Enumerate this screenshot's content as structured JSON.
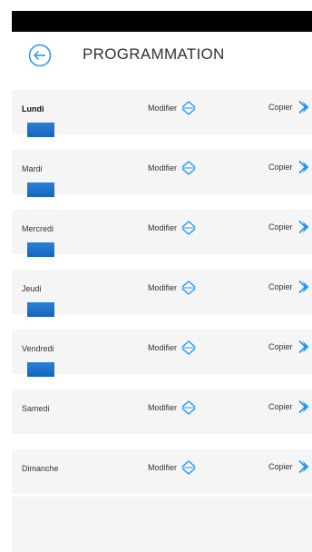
{
  "header": {
    "title": "PROGRAMMATION"
  },
  "colors": {
    "accent": "#2196F3",
    "bar": "#1E6FC8",
    "row_bg": "#F5F5F5"
  },
  "icons": {
    "back": "arrow-left-circle-icon",
    "modify": "chevron-up-down-icon",
    "copy": "chevron-right-copy-icon"
  },
  "days": [
    {
      "name": "Lundi",
      "modify": "Modifier",
      "copy": "Copier",
      "has_bar": true,
      "selected": true
    },
    {
      "name": "Mardi",
      "modify": "Modifier",
      "copy": "Copier",
      "has_bar": true,
      "selected": false
    },
    {
      "name": "Mercredi",
      "modify": "Modifier",
      "copy": "Copier",
      "has_bar": true,
      "selected": false
    },
    {
      "name": "Jeudi",
      "modify": "Modifier",
      "copy": "Copier",
      "has_bar": true,
      "selected": false
    },
    {
      "name": "Vendredi",
      "modify": "Modifier",
      "copy": "Copier",
      "has_bar": true,
      "selected": false
    },
    {
      "name": "Samedi",
      "modify": "Modifier",
      "copy": "Copier",
      "has_bar": false,
      "selected": false
    },
    {
      "name": "Dimanche",
      "modify": "Modifier",
      "copy": "Copier",
      "has_bar": false,
      "selected": false
    }
  ]
}
